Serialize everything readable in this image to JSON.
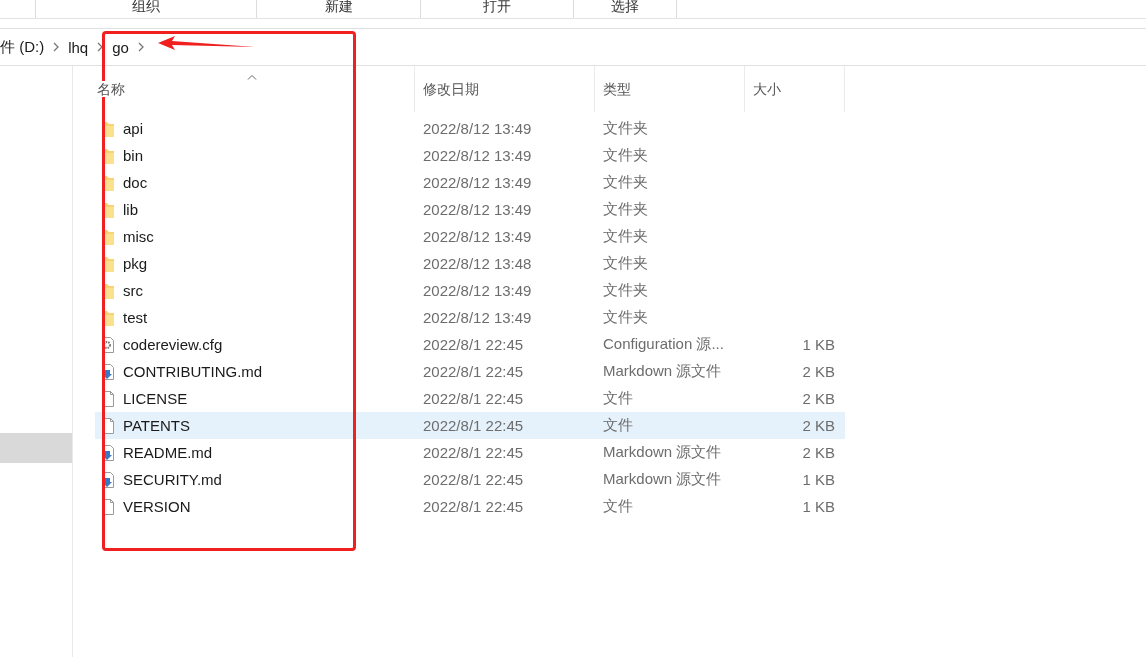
{
  "ribbon_groups": [
    "组织",
    "新建",
    "打开",
    "选择"
  ],
  "breadcrumb": [
    "件 (D:)",
    "lhq",
    "go"
  ],
  "nav": {
    "items": [
      {
        "selected": true
      }
    ]
  },
  "columns": [
    "名称",
    "修改日期",
    "类型",
    "大小"
  ],
  "rows": [
    {
      "kind": "folder",
      "name": "api",
      "date": "2022/8/12 13:49",
      "type": "文件夹",
      "selected": false
    },
    {
      "kind": "folder",
      "name": "bin",
      "date": "2022/8/12 13:49",
      "type": "文件夹",
      "selected": false
    },
    {
      "kind": "folder",
      "name": "doc",
      "date": "2022/8/12 13:49",
      "type": "文件夹",
      "selected": false
    },
    {
      "kind": "folder",
      "name": "lib",
      "date": "2022/8/12 13:49",
      "type": "文件夹",
      "selected": false
    },
    {
      "kind": "folder",
      "name": "misc",
      "date": "2022/8/12 13:49",
      "type": "文件夹",
      "selected": false
    },
    {
      "kind": "folder",
      "name": "pkg",
      "date": "2022/8/12 13:48",
      "type": "文件夹",
      "selected": false
    },
    {
      "kind": "folder",
      "name": "src",
      "date": "2022/8/12 13:49",
      "type": "文件夹",
      "selected": false
    },
    {
      "kind": "folder",
      "name": "test",
      "date": "2022/8/12 13:49",
      "type": "文件夹",
      "selected": false
    },
    {
      "kind": "config",
      "name": "codereview.cfg",
      "date": "2022/8/1 22:45",
      "type": "Configuration 源...",
      "size": "1 KB",
      "selected": false
    },
    {
      "kind": "markdown",
      "name": "CONTRIBUTING.md",
      "date": "2022/8/1 22:45",
      "type": "Markdown 源文件",
      "size": "2 KB",
      "selected": false
    },
    {
      "kind": "file",
      "name": "LICENSE",
      "date": "2022/8/1 22:45",
      "type": "文件",
      "size": "2 KB",
      "selected": false
    },
    {
      "kind": "file",
      "name": "PATENTS",
      "date": "2022/8/1 22:45",
      "type": "文件",
      "size": "2 KB",
      "selected": true
    },
    {
      "kind": "markdown",
      "name": "README.md",
      "date": "2022/8/1 22:45",
      "type": "Markdown 源文件",
      "size": "2 KB",
      "selected": false
    },
    {
      "kind": "markdown",
      "name": "SECURITY.md",
      "date": "2022/8/1 22:45",
      "type": "Markdown 源文件",
      "size": "1 KB",
      "selected": false
    },
    {
      "kind": "file",
      "name": "VERSION",
      "date": "2022/8/1 22:45",
      "type": "文件",
      "size": "1 KB",
      "selected": false
    }
  ]
}
